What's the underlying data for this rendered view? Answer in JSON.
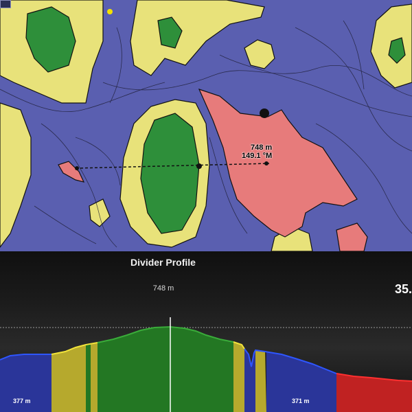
{
  "map": {
    "cursor_readout": {
      "distance": "748 m",
      "bearing": "149.1 °M"
    }
  },
  "profile_panel": {
    "title": "Divider Profile",
    "cursor_distance": "748 m",
    "value_readout": "35.",
    "left_segment_label": "377 m",
    "right_segment_label": "371 m"
  },
  "colors": {
    "deep": "#4a4ca6",
    "shallow": "#e8e27a",
    "land": "#2e8f3a",
    "danger": "#e77b7b",
    "profile_blue": "#2a3599",
    "profile_yellow": "#b6a92d",
    "profile_green": "#237723",
    "profile_red": "#c02222"
  }
}
